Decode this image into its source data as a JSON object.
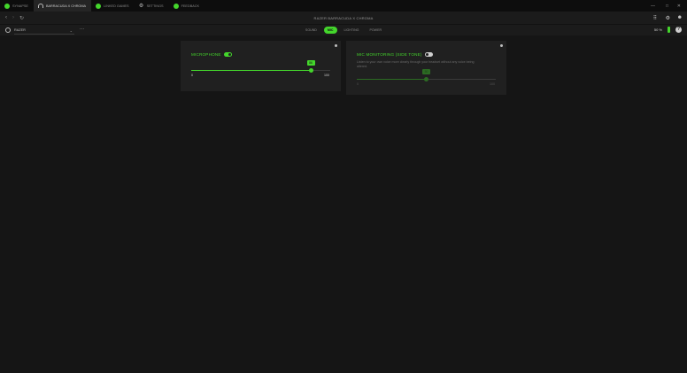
{
  "tabs": [
    {
      "label": "SYNAPSE",
      "icon": "synapse-logo-icon",
      "active": false
    },
    {
      "label": "BARRACUDA X CHROMA",
      "icon": "headset-icon",
      "active": true
    },
    {
      "label": "LINKED GAMES",
      "icon": "game-controller-icon",
      "active": false
    },
    {
      "label": "SETTINGS",
      "icon": "gear-icon",
      "active": false
    },
    {
      "label": "FEEDBACK",
      "icon": "feedback-icon",
      "active": false
    }
  ],
  "page_title": "RAZER BARRACUDA X CHROMA",
  "profile": {
    "value": "RAZER"
  },
  "subtabs": [
    "SOUND",
    "MIC",
    "LIGHTING",
    "POWER"
  ],
  "active_subtab": "MIC",
  "battery": {
    "label": "50 %"
  },
  "microphone": {
    "title": "MICROPHONE",
    "enabled": true,
    "slider": {
      "value": 86,
      "min_label": "0",
      "max_label": "100",
      "value_label": "86"
    }
  },
  "mic_monitoring": {
    "title": "MIC MONITORING (SIDE TONE)",
    "enabled": false,
    "description": "Listen to your own voice more clearly through your headset without any voice being altered.",
    "slider": {
      "value": 50,
      "min_label": "0",
      "max_label": "100",
      "value_label": "50"
    }
  },
  "colors": {
    "accent": "#44d62c",
    "background": "#151515",
    "card": "#202020"
  }
}
